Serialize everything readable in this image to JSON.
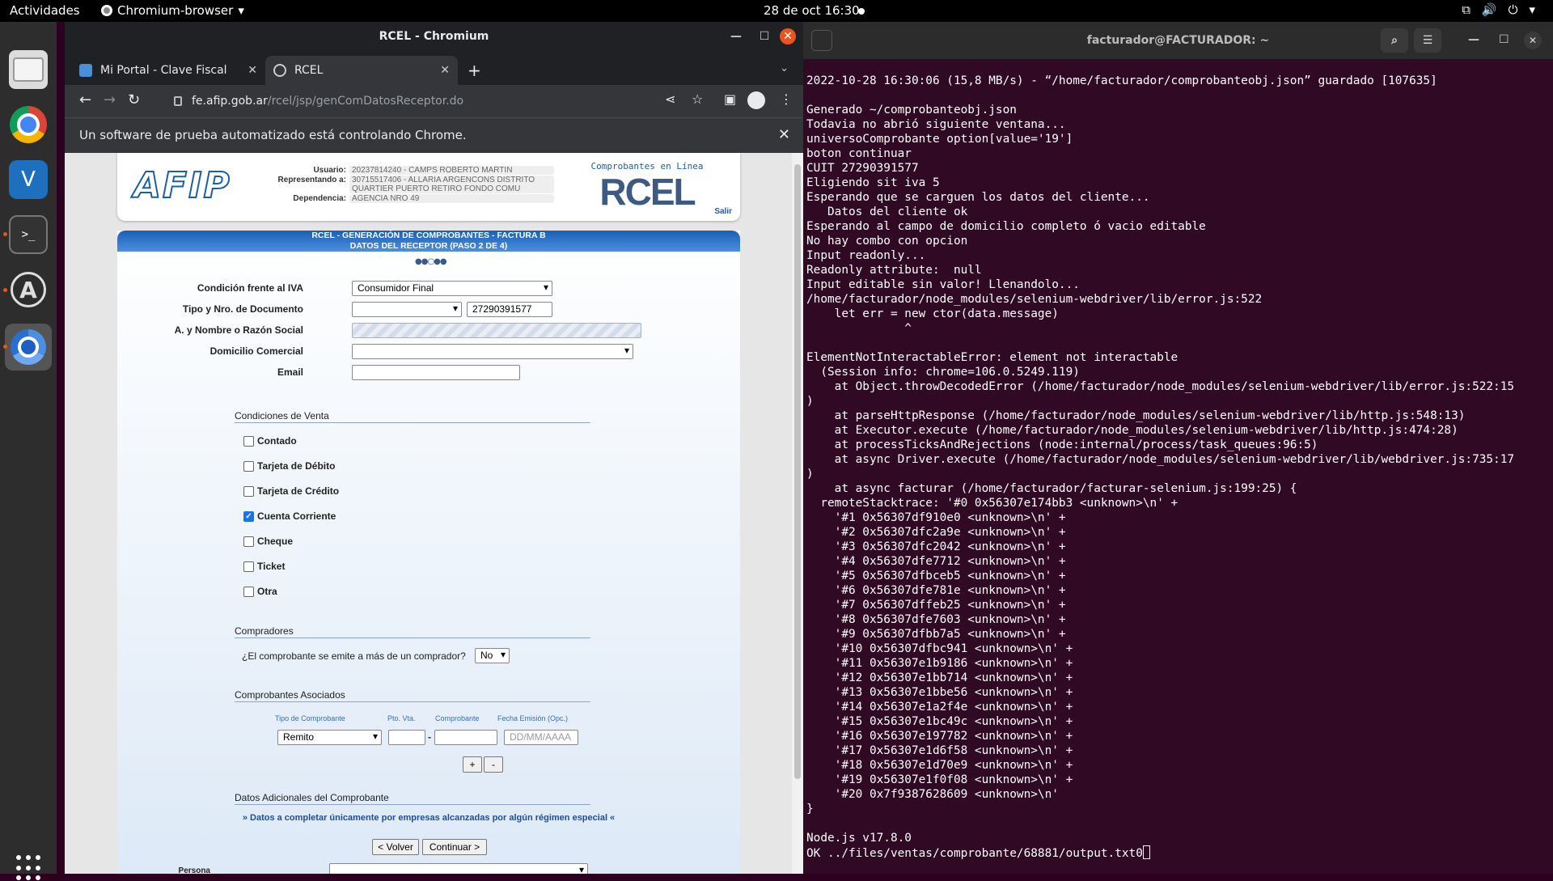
{
  "topbar": {
    "activities": "Actividades",
    "app_name": "Chromium-browser",
    "app_caret": "▾",
    "clock": "28 de oct  16:30",
    "icons": [
      "network-icon",
      "volume-icon",
      "power-icon"
    ]
  },
  "chrome": {
    "window_title": "RCEL - Chromium",
    "tabs": [
      {
        "label": "Mi Portal - Clave Fiscal"
      },
      {
        "label": "RCEL"
      }
    ],
    "url_host": "fe.afip.gob.ar",
    "url_path": "/rcel/jsp/genComDatosReceptor.do",
    "infobar": "Un software de prueba automatizado está controlando Chrome."
  },
  "header": {
    "logo_text": "AFIP",
    "usuario_label": "Usuario:",
    "usuario_value": "20237814240 - CAMPS ROBERTO MARTIN",
    "representando_label": "Representando a:",
    "representando_value": "30715517406 - ALLARIA ARGENCONS DISTRITO QUARTIER PUERTO RETIRO FONDO COMU",
    "dependencia_label": "Dependencia:",
    "dependencia_value": "AGENCIA NRO 49",
    "rcel_sub": "Comprobantes en Línea",
    "rcel_big": "RCEL",
    "salir": "Salir"
  },
  "form": {
    "title_line1": "RCEL - GENERACIÓN DE COMPROBANTES - FACTURA B",
    "title_line2": "DATOS DEL RECEPTOR (PASO 2 DE 4)",
    "steps": "●●○●●",
    "iva_label": "Condición frente al IVA",
    "iva_value": "Consumidor Final",
    "doc_label": "Tipo y Nro. de Documento",
    "doc_type_value": "",
    "doc_number_value": "27290391577",
    "nombre_label": "A. y Nombre o Razón Social",
    "domicilio_label": "Domicilio Comercial",
    "domicilio_value": "",
    "email_label": "Email",
    "email_value": "",
    "condiciones_title": "Condiciones de Venta",
    "condiciones": [
      {
        "label": "Contado",
        "checked": false
      },
      {
        "label": "Tarjeta de Débito",
        "checked": false
      },
      {
        "label": "Tarjeta de Crédito",
        "checked": false
      },
      {
        "label": "Cuenta Corriente",
        "checked": true
      },
      {
        "label": "Cheque",
        "checked": false
      },
      {
        "label": "Ticket",
        "checked": false
      },
      {
        "label": "Otra",
        "checked": false
      }
    ],
    "compradores_title": "Compradores",
    "compradores_question": "¿El comprobante se emite a más de un comprador?",
    "compradores_value": "No",
    "asociados_title": "Comprobantes Asociados",
    "col_tipo": "Tipo de Comprobante",
    "col_ptovta": "Pto. Vta.",
    "col_comprobante": "Comprobante",
    "col_fecha": "Fecha Emisión (Opc.)",
    "tipo_value": "Remito",
    "dash": "-",
    "fecha_placeholder": "DD/MM/AAAA",
    "add_label": "+",
    "remove_label": "-",
    "adicionales_title": "Datos Adicionales del Comprobante",
    "adicionales_note": "» Datos a completar únicamente por empresas alcanzadas por algún régimen especial «",
    "back_label": "< Volver",
    "continue_label": "Continuar >",
    "persona_label": "Persona"
  },
  "terminal": {
    "title": "facturador@FACTURADOR: ~",
    "lines": [
      "2022-10-28 16:30:06 (15,8 MB/s) - “/home/facturador/comprobanteobj.json” guardado [107635]",
      "",
      "Generado ~/comprobanteobj.json",
      "Todavia no abrió siguiente ventana...",
      "universoComprobante option[value='19']",
      "boton continuar",
      "CUIT 27290391577",
      "Eligiendo sit iva 5",
      "Esperando que se carguen los datos del cliente...",
      "   Datos del cliente ok",
      "Esperando al campo de domicilio completo ó vacio editable",
      "No hay combo con opcion",
      "Input readonly...",
      "Readonly attribute:  null",
      "Input editable sin valor! Llenandolo...",
      "/home/facturador/node_modules/selenium-webdriver/lib/error.js:522",
      "    let err = new ctor(data.message)",
      "              ^",
      "",
      "ElementNotInteractableError: element not interactable",
      "  (Session info: chrome=106.0.5249.119)",
      "    at Object.throwDecodedError (/home/facturador/node_modules/selenium-webdriver/lib/error.js:522:15",
      ")",
      "    at parseHttpResponse (/home/facturador/node_modules/selenium-webdriver/lib/http.js:548:13)",
      "    at Executor.execute (/home/facturador/node_modules/selenium-webdriver/lib/http.js:474:28)",
      "    at processTicksAndRejections (node:internal/process/task_queues:96:5)",
      "    at async Driver.execute (/home/facturador/node_modules/selenium-webdriver/lib/webdriver.js:735:17",
      ")",
      "    at async facturar (/home/facturador/facturar-selenium.js:199:25) {",
      "  remoteStacktrace: '#0 0x56307e174bb3 <unknown>\\n' +",
      "    '#1 0x56307df910e0 <unknown>\\n' +",
      "    '#2 0x56307dfc2a9e <unknown>\\n' +",
      "    '#3 0x56307dfc2042 <unknown>\\n' +",
      "    '#4 0x56307dfe7712 <unknown>\\n' +",
      "    '#5 0x56307dfbceb5 <unknown>\\n' +",
      "    '#6 0x56307dfe781e <unknown>\\n' +",
      "    '#7 0x56307dffeb25 <unknown>\\n' +",
      "    '#8 0x56307dfe7603 <unknown>\\n' +",
      "    '#9 0x56307dfbb7a5 <unknown>\\n' +",
      "    '#10 0x56307dfbc941 <unknown>\\n' +",
      "    '#11 0x56307e1b9186 <unknown>\\n' +",
      "    '#12 0x56307e1bb714 <unknown>\\n' +",
      "    '#13 0x56307e1bbe56 <unknown>\\n' +",
      "    '#14 0x56307e1a2f4e <unknown>\\n' +",
      "    '#15 0x56307e1bc49c <unknown>\\n' +",
      "    '#16 0x56307e197782 <unknown>\\n' +",
      "    '#17 0x56307e1d6f58 <unknown>\\n' +",
      "    '#18 0x56307e1d70e9 <unknown>\\n' +",
      "    '#19 0x56307e1f0f08 <unknown>\\n' +",
      "    '#20 0x7f9387628609 <unknown>\\n'",
      "}",
      "",
      "Node.js v17.8.0",
      "OK ../files/ventas/comprobante/68881/output.txt0"
    ]
  }
}
